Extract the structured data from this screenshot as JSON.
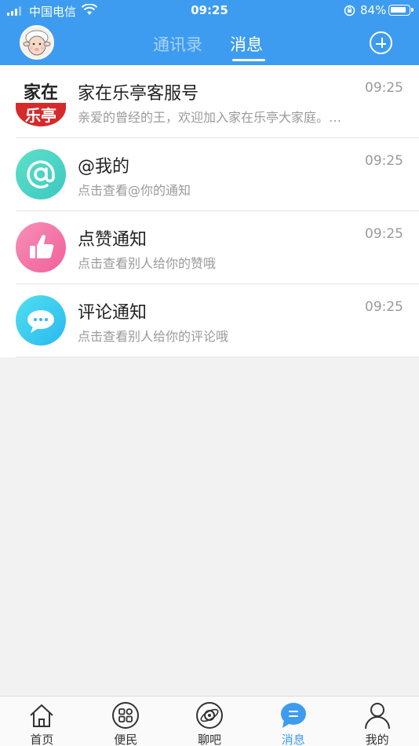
{
  "status_bar": {
    "carrier": "中国电信",
    "time": "09:25",
    "battery_pct": "84%"
  },
  "header": {
    "tabs": [
      {
        "label": "通讯录",
        "active": false
      },
      {
        "label": "消息",
        "active": true
      }
    ],
    "avatar": "sheep-avatar",
    "add_icon": "plus-circle-icon"
  },
  "messages": [
    {
      "title": "家在乐亭客服号",
      "subtitle": "亲爱的曾经的王，欢迎加入家在乐亭大家庭。…",
      "time": "09:25",
      "icon": "jia-zai-le-ting-logo",
      "logo_text": [
        "家在",
        "乐亭"
      ]
    },
    {
      "title": "@我的",
      "subtitle": "点击查看@你的通知",
      "time": "09:25",
      "icon": "at-icon"
    },
    {
      "title": "点赞通知",
      "subtitle": "点击查看别人给你的赞哦",
      "time": "09:25",
      "icon": "thumbs-up-icon"
    },
    {
      "title": "评论通知",
      "subtitle": "点击查看别人给你的评论哦",
      "time": "09:25",
      "icon": "comment-icon"
    }
  ],
  "bottom_nav": [
    {
      "label": "首页",
      "icon": "home-icon",
      "active": false
    },
    {
      "label": "便民",
      "icon": "grid-icon",
      "active": false
    },
    {
      "label": "聊吧",
      "icon": "chat-orbit-icon",
      "active": false
    },
    {
      "label": "消息",
      "icon": "message-bubble-icon",
      "active": true
    },
    {
      "label": "我的",
      "icon": "person-icon",
      "active": false
    }
  ],
  "colors": {
    "header_bg": "#3d9cf0",
    "active_tab": "#ffffff",
    "inactive_tab": "#a9d2f8",
    "nav_active": "#3d9cf0"
  }
}
